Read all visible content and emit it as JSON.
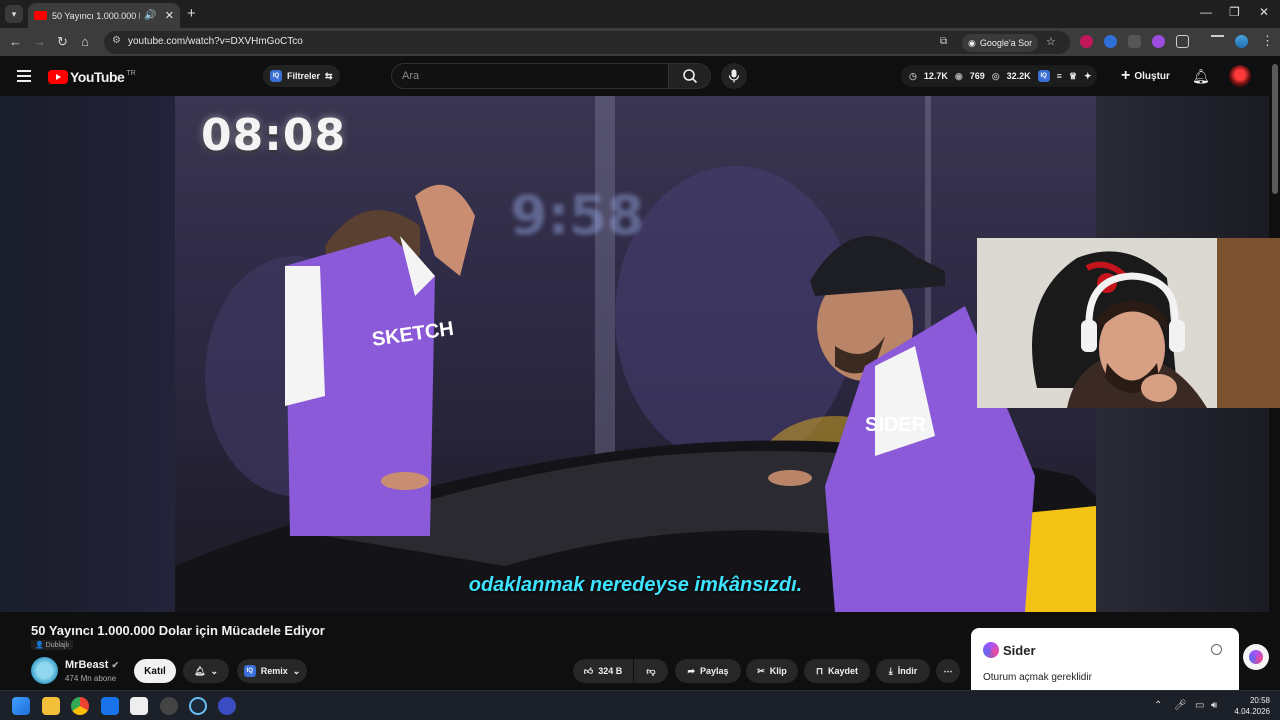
{
  "browser": {
    "tab_title": "50 Yayıncı 1.000.000 Dolar için Mücadele Ediyor",
    "url": "youtube.com/watch?v=DXVHmGoCTco",
    "google_ask": "Google'a Sor"
  },
  "youtube": {
    "logo_text": "YouTube",
    "region": "TR",
    "filters_label": "Filtreler",
    "iq_label": "IQ",
    "search_placeholder": "Ara",
    "stats": {
      "views": "12.7K",
      "likes": "769",
      "watch": "32.2K"
    },
    "create_label": "Oluştur"
  },
  "video": {
    "timer_main": "08:08",
    "timer_bg": "9:58",
    "subtitle": "odaklanmak neredeyse imkânsızdı.",
    "jersey_text": "SKETCH",
    "jersey_text_2": "SIDER"
  },
  "meta": {
    "title": "50 Yayıncı 1.000.000 Dolar için Mücadele Ediyor",
    "dub_badge": "Dublajlı",
    "channel": "MrBeast",
    "subscribers": "474 Mn abone",
    "join": "Katıl",
    "remix": "Remix",
    "like_count": "324 B",
    "share": "Paylaş",
    "clip": "Klip",
    "save": "Kaydet",
    "download": "İndir"
  },
  "sider": {
    "name": "Sider",
    "message": "Oturum açmak gereklidir"
  },
  "taskbar": {
    "time": "20:58",
    "date": "4.04.2026"
  },
  "colors": {
    "youtube_red": "#ff0000",
    "subtitle_cyan": "#3ee3ff",
    "jersey_purple": "#8a5ad8"
  }
}
